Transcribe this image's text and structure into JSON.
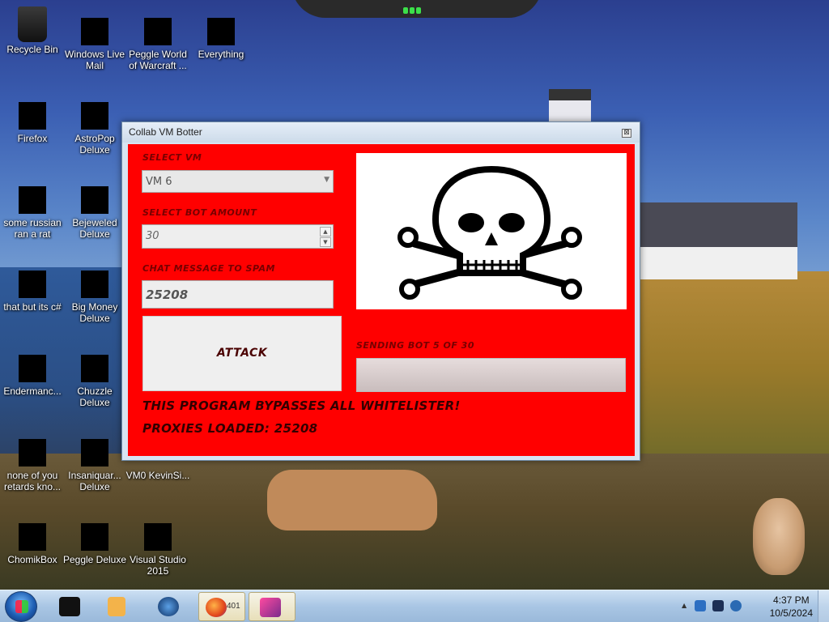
{
  "desktop": {
    "icons": [
      {
        "label": "Recycle Bin"
      },
      {
        "label": "Windows Live Mail"
      },
      {
        "label": "Peggle World of Warcraft ..."
      },
      {
        "label": "Everything"
      },
      {
        "label": "Firefox"
      },
      {
        "label": "AstroPop Deluxe"
      },
      {
        "label": "some russian ran a rat"
      },
      {
        "label": "Bejeweled Deluxe"
      },
      {
        "label": "that but its c#"
      },
      {
        "label": "Big Money Deluxe"
      },
      {
        "label": "Endermanc..."
      },
      {
        "label": "Chuzzle Deluxe"
      },
      {
        "label": "none of you retards kno..."
      },
      {
        "label": "Insaniquar... Deluxe"
      },
      {
        "label": "VM0 KevinSi..."
      },
      {
        "label": "ChomikBox"
      },
      {
        "label": "Peggle Deluxe"
      },
      {
        "label": "Visual Studio 2015"
      }
    ]
  },
  "window": {
    "title": "Collab VM Botter",
    "close_glyph": "⊠",
    "select_vm_label": "SELECT VM",
    "select_vm_value": "VM 6",
    "bot_amount_label": "SELECT BOT AMOUNT",
    "bot_amount_value": "30",
    "chat_label": "CHAT MESSAGE TO SPAM",
    "chat_value": "25208",
    "attack_label": "ATTACK",
    "status_text": "SENDING BOT 5 OF 30",
    "progress_fraction": 0.0,
    "whitelist_text": "THIS PROGRAM BYPASSES ALL WHITELISTER!",
    "proxies_text": "PROXIES LOADED: 25208",
    "colors": {
      "body_bg": "#ff0000",
      "text": "#330000"
    }
  },
  "taskbar": {
    "firefox_count": "401",
    "clock_time": "4:37 PM",
    "clock_date": "10/5/2024"
  }
}
